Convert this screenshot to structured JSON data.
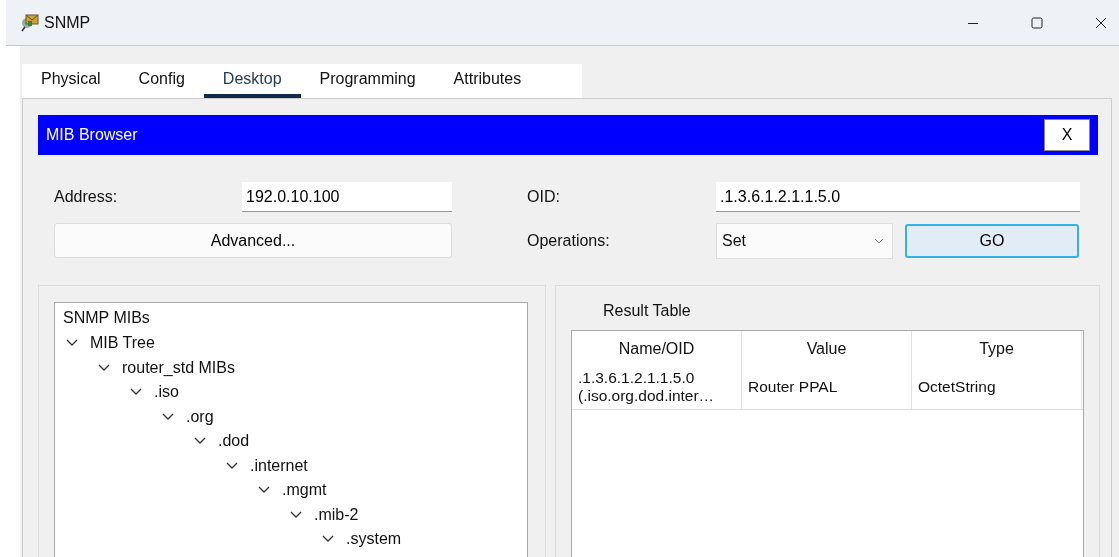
{
  "window": {
    "title": "SNMP"
  },
  "tabs": [
    {
      "label": "Physical",
      "selected": false
    },
    {
      "label": "Config",
      "selected": false
    },
    {
      "label": "Desktop",
      "selected": true
    },
    {
      "label": "Programming",
      "selected": false
    },
    {
      "label": "Attributes",
      "selected": false
    }
  ],
  "app": {
    "title": "MIB Browser",
    "close_label": "X"
  },
  "form": {
    "address_label": "Address:",
    "address_value": "192.0.10.100",
    "oid_label": "OID:",
    "oid_value": ".1.3.6.1.2.1.1.5.0",
    "advanced_button": "Advanced...",
    "operations_label": "Operations:",
    "operations_value": "Set",
    "go_button": {
      "label": "GO",
      "focused": true
    }
  },
  "tree": {
    "title": "SNMP MIBs",
    "items": [
      {
        "label": "MIB Tree",
        "expanded": true,
        "children": [
          {
            "label": "router_std MIBs",
            "expanded": true,
            "children": [
              {
                "label": ".iso",
                "expanded": true,
                "children": [
                  {
                    "label": ".org",
                    "expanded": true,
                    "children": [
                      {
                        "label": ".dod",
                        "expanded": true,
                        "children": [
                          {
                            "label": ".internet",
                            "expanded": true,
                            "children": [
                              {
                                "label": ".mgmt",
                                "expanded": true,
                                "children": [
                                  {
                                    "label": ".mib-2",
                                    "expanded": true,
                                    "children": [
                                      {
                                        "label": ".system",
                                        "expanded": true
                                      }
                                    ]
                                  }
                                ]
                              }
                            ]
                          }
                        ]
                      }
                    ]
                  }
                ]
              }
            ]
          }
        ]
      }
    ]
  },
  "result": {
    "title": "Result Table",
    "columns": [
      "Name/OID",
      "Value",
      "Type"
    ],
    "rows": [
      [
        ".1.3.6.1.2.1.1.5.0\n(.iso.org.dod.inter…",
        "Router PPAL",
        "OctetString"
      ]
    ]
  }
}
